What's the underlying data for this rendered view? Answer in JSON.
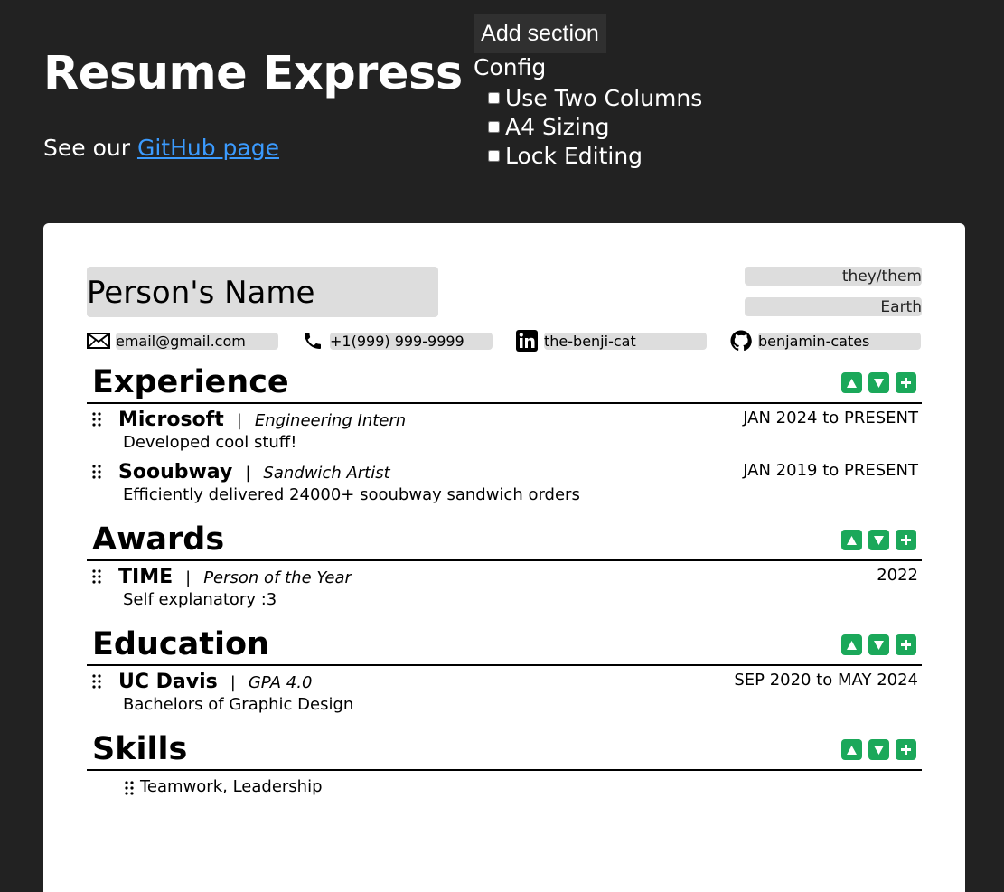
{
  "app": {
    "title": "Resume Express",
    "github_prefix": "See our ",
    "github_link": "GitHub page"
  },
  "toolbar": {
    "add_section": "Add section",
    "config_label": "Config",
    "options": [
      {
        "label": "Use Two Columns",
        "checked": false
      },
      {
        "label": "A4 Sizing",
        "checked": false
      },
      {
        "label": "Lock Editing",
        "checked": false
      }
    ]
  },
  "resume": {
    "name": "Person's Name",
    "pronouns": "they/them",
    "location": "Earth",
    "contacts": {
      "email": {
        "icon": "mail-icon",
        "value": "email@gmail.com"
      },
      "phone": {
        "icon": "phone-icon",
        "value": "+1(999) 999-9999"
      },
      "linkedin": {
        "icon": "linkedin-icon",
        "value": "the-benji-cat"
      },
      "github": {
        "icon": "github-icon",
        "value": "benjamin-cates"
      }
    },
    "sections": [
      {
        "title": "Experience",
        "entries": [
          {
            "org": "Microsoft",
            "role": "Engineering Intern",
            "date": "JAN 2024 to PRESENT",
            "desc": "Developed cool stuff!"
          },
          {
            "org": "Sooubway",
            "role": "Sandwich Artist",
            "date": "JAN 2019 to PRESENT",
            "desc": "Efficiently delivered 24000+ sooubway sandwich orders"
          }
        ]
      },
      {
        "title": "Awards",
        "entries": [
          {
            "org": "TIME",
            "role": "Person of the Year",
            "date": "2022",
            "desc": "Self explanatory :3"
          }
        ]
      },
      {
        "title": "Education",
        "entries": [
          {
            "org": "UC Davis",
            "role": "GPA 4.0",
            "date": "SEP 2020 to MAY 2024",
            "desc": "Bachelors of Graphic Design"
          }
        ]
      },
      {
        "title": "Skills",
        "skills": "Teamwork, Leadership"
      }
    ],
    "separator": "|"
  },
  "colors": {
    "background": "#222222",
    "link": "#3b9bff",
    "control_green": "#1ba85a",
    "field_gray": "#dddddd"
  }
}
